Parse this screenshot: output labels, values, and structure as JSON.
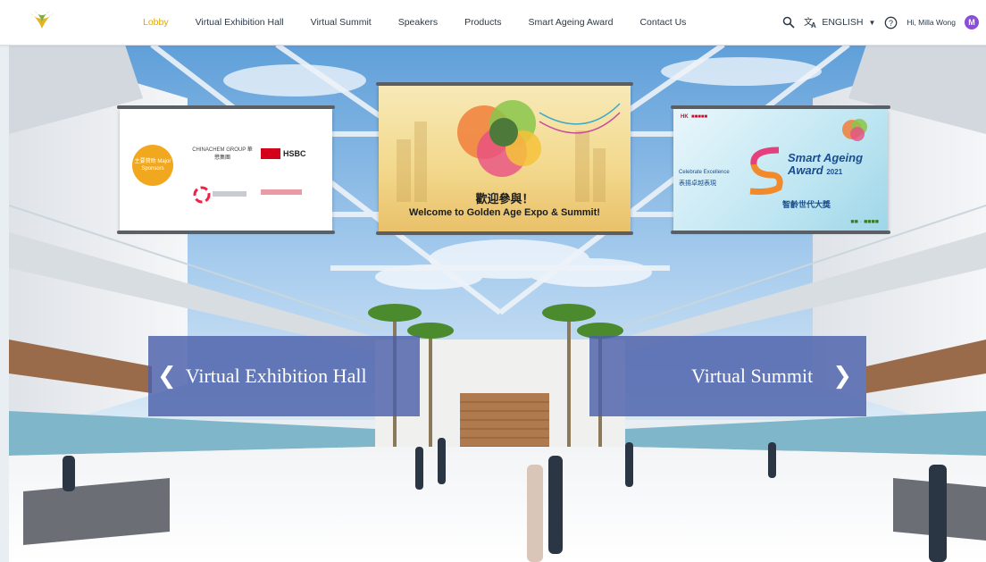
{
  "nav": {
    "items": [
      {
        "label": "Lobby",
        "active": true
      },
      {
        "label": "Virtual Exhibition Hall",
        "active": false
      },
      {
        "label": "Virtual Summit",
        "active": false
      },
      {
        "label": "Speakers",
        "active": false
      },
      {
        "label": "Products",
        "active": false
      },
      {
        "label": "Smart Ageing Award",
        "active": false
      },
      {
        "label": "Contact Us",
        "active": false
      }
    ],
    "language": "ENGLISH",
    "greeting": "Hi, Milla Wong",
    "avatar_initial": "M",
    "accent_color": "#e0a800",
    "avatar_color": "#8a4fd8"
  },
  "banners": {
    "sponsors": {
      "badge": "主要贊助 Major Sponsors",
      "logos": [
        "CHINACHEM GROUP 華懋集團",
        "HSBC"
      ]
    },
    "welcome": {
      "cn": "歡迎參與！",
      "en": "Welcome to Golden Age Expo & Summit!"
    },
    "award": {
      "left_en": "Celebrate Excellence",
      "left_cn": "表揚卓越表現",
      "title": "Smart Ageing Award",
      "year": "2021",
      "cn": "智齡世代大獎"
    }
  },
  "panels": {
    "left_label": "Virtual Exhibition Hall",
    "right_label": "Virtual Summit"
  }
}
